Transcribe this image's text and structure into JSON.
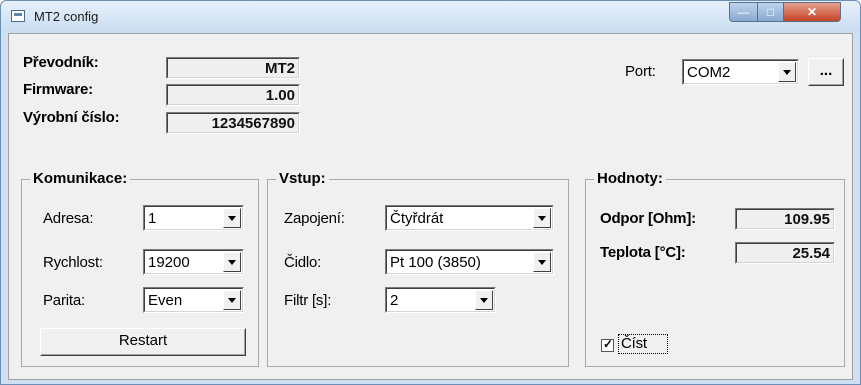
{
  "window": {
    "title": "MT2 config"
  },
  "info": {
    "prevodnik_label": "Převodník:",
    "prevodnik_value": "MT2",
    "firmware_label": "Firmware:",
    "firmware_value": "1.00",
    "serial_label": "Výrobní číslo:",
    "serial_value": "1234567890"
  },
  "port": {
    "label": "Port:",
    "value": "COM2",
    "browse_label": "..."
  },
  "komunikace": {
    "title": "Komunikace:",
    "adresa_label": "Adresa:",
    "adresa_value": "1",
    "rychlost_label": "Rychlost:",
    "rychlost_value": "19200",
    "parita_label": "Parita:",
    "parita_value": "Even",
    "restart_label": "Restart"
  },
  "vstup": {
    "title": "Vstup:",
    "zapojeni_label": "Zapojení:",
    "zapojeni_value": "Čtyřdrát",
    "cidlo_label": "Čidlo:",
    "cidlo_value": "Pt 100 (3850)",
    "filtr_label": "Filtr [s]:",
    "filtr_value": "2"
  },
  "hodnoty": {
    "title": "Hodnoty:",
    "odpor_label": "Odpor [Ohm]:",
    "odpor_value": "109.95",
    "teplota_label": "Teplota [°C]:",
    "teplota_value": "25.54",
    "cist_label": "Číst",
    "cist_checked": true
  }
}
